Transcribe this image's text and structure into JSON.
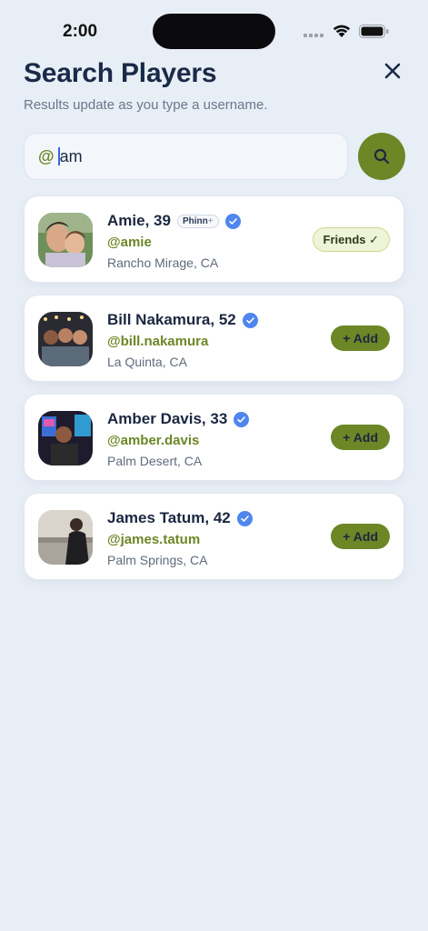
{
  "status_bar": {
    "time": "2:00"
  },
  "header": {
    "title": "Search Players",
    "subtitle": "Results update as you type a username."
  },
  "search": {
    "prefix": "@",
    "value": "am"
  },
  "colors": {
    "accent": "#6d8626",
    "verified": "#4f86ef",
    "background": "#e8eef6"
  },
  "results": [
    {
      "name": "Amie, 39",
      "badge": "Phinn",
      "badge_suffix": "+",
      "verified": true,
      "handle": "@amie",
      "location": "Rancho Mirage, CA",
      "action": "Friends ✓",
      "action_type": "friends"
    },
    {
      "name": "Bill Nakamura, 52",
      "verified": true,
      "handle": "@bill.nakamura",
      "location": "La Quinta, CA",
      "action": "+ Add",
      "action_type": "add"
    },
    {
      "name": "Amber Davis, 33",
      "verified": true,
      "handle": "@amber.davis",
      "location": "Palm Desert, CA",
      "action": "+ Add",
      "action_type": "add"
    },
    {
      "name": "James Tatum, 42",
      "verified": true,
      "handle": "@james.tatum",
      "location": "Palm Springs, CA",
      "action": "+ Add",
      "action_type": "add"
    }
  ]
}
